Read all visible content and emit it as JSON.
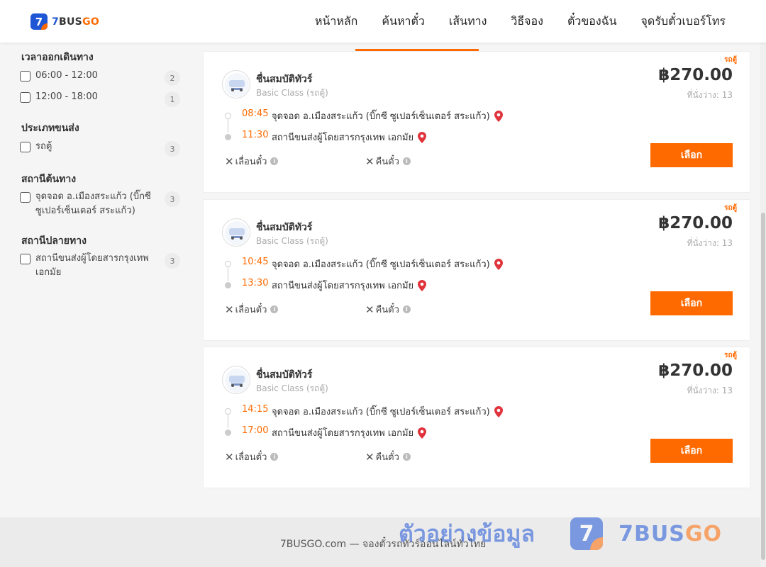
{
  "header": {
    "logo_badge": "7",
    "logo_brand_a": "7",
    "logo_brand_b": "BUS",
    "logo_brand_c": "GO",
    "nav": [
      "หน้าหลัก",
      "ค้นหาตั๋ว",
      "เส้นทาง",
      "วิธีจอง",
      "ตั๋วของฉัน",
      "จุดรับตั๋วเบอร์โทร"
    ]
  },
  "filters": {
    "departure_time": {
      "title": "เวลาออกเดินทาง",
      "options": [
        {
          "label": "06:00 - 12:00",
          "count": "2"
        },
        {
          "label": "12:00 - 18:00",
          "count": "1"
        }
      ]
    },
    "transport_type": {
      "title": "ประเภทขนส่ง",
      "options": [
        {
          "label": "รถตู้",
          "count": "3"
        }
      ]
    },
    "origin_station": {
      "title": "สถานีต้นทาง",
      "options": [
        {
          "label": "จุดจอด อ.เมืองสระแก้ว (บิ๊กซี ซูเปอร์เซ็นเตอร์ สระแก้ว)",
          "count": "3"
        }
      ]
    },
    "destination_station": {
      "title": "สถานีปลายทาง",
      "options": [
        {
          "label": "สถานีขนส่งผู้โดยสารกรุงเทพ เอกมัย",
          "count": "3"
        }
      ]
    }
  },
  "trips": [
    {
      "tag": "รถตู้",
      "operator": "ชื่นสมบัติทัวร์",
      "class": "Basic Class (รถตู้)",
      "price": "฿270.00",
      "seats": "ที่นั่งว่าง: 13",
      "dep_time": "08:45",
      "dep_station": "จุดจอด อ.เมืองสระแก้ว (บิ๊กซี ซูเปอร์เซ็นเตอร์ สระแก้ว)",
      "arr_time": "11:30",
      "arr_station": "สถานีขนส่งผู้โดยสารกรุงเทพ เอกมัย",
      "policy_change": "เลื่อนตั๋ว",
      "policy_refund": "คืนตั๋ว",
      "button": "เลือก"
    },
    {
      "tag": "รถตู้",
      "operator": "ชื่นสมบัติทัวร์",
      "class": "Basic Class (รถตู้)",
      "price": "฿270.00",
      "seats": "ที่นั่งว่าง: 13",
      "dep_time": "10:45",
      "dep_station": "จุดจอด อ.เมืองสระแก้ว (บิ๊กซี ซูเปอร์เซ็นเตอร์ สระแก้ว)",
      "arr_time": "13:30",
      "arr_station": "สถานีขนส่งผู้โดยสารกรุงเทพ เอกมัย",
      "policy_change": "เลื่อนตั๋ว",
      "policy_refund": "คืนตั๋ว",
      "button": "เลือก"
    },
    {
      "tag": "รถตู้",
      "operator": "ชื่นสมบัติทัวร์",
      "class": "Basic Class (รถตู้)",
      "price": "฿270.00",
      "seats": "ที่นั่งว่าง: 13",
      "dep_time": "14:15",
      "dep_station": "จุดจอด อ.เมืองสระแก้ว (บิ๊กซี ซูเปอร์เซ็นเตอร์ สระแก้ว)",
      "arr_time": "17:00",
      "arr_station": "สถานีขนส่งผู้โดยสารกรุงเทพ เอกมัย",
      "policy_change": "เลื่อนตั๋ว",
      "policy_refund": "คืนตั๋ว",
      "button": "เลือก"
    }
  ],
  "footer": {
    "text": "7BUSGO.com — จองตั๋วรถทัวร์ออนไลน์ทั่วไทย"
  },
  "watermark": {
    "text": "ตัวอย่างข้อมูล",
    "badge": "7",
    "brand_a": "7BUS",
    "brand_b": "GO"
  },
  "colors": {
    "accent": "#ff6a00",
    "brand_blue": "#1f56d6"
  }
}
